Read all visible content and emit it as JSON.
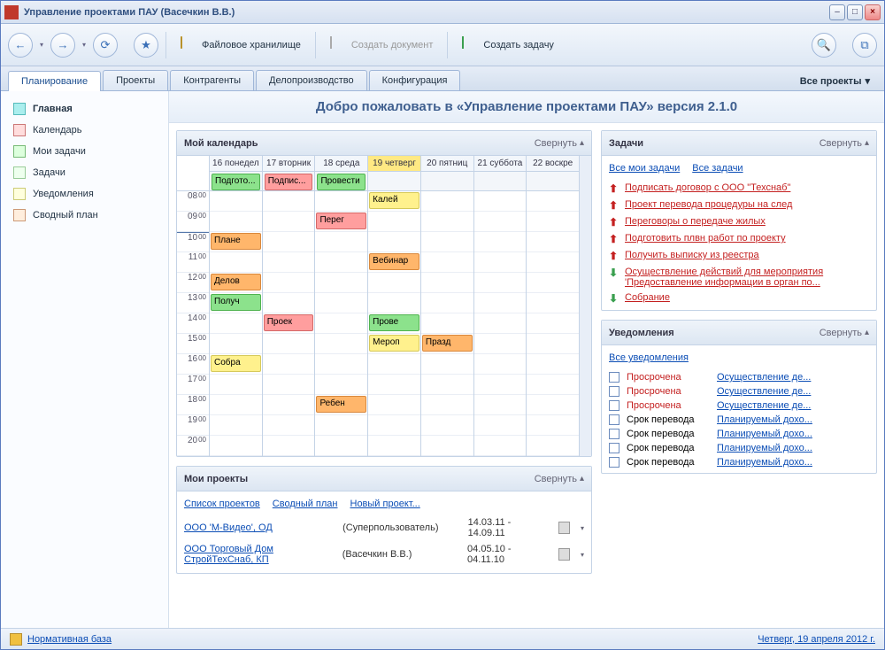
{
  "window": {
    "title": "Управление проектами ПАУ (Васечкин В.В.)"
  },
  "toolbar": {
    "file_storage": "Файловое хранилище",
    "create_doc": "Создать документ",
    "create_task": "Создать задачу"
  },
  "tabs": {
    "items": [
      "Планирование",
      "Проекты",
      "Контрагенты",
      "Делопроизводство",
      "Конфигурация"
    ],
    "projects": "Все проекты"
  },
  "sidebar": {
    "items": [
      {
        "label": "Главная"
      },
      {
        "label": "Календарь"
      },
      {
        "label": "Мои задачи"
      },
      {
        "label": "Задачи"
      },
      {
        "label": "Уведомления"
      },
      {
        "label": "Сводный план"
      }
    ]
  },
  "welcome": "Добро пожаловать в «Управление проектами ПАУ» версия 2.1.0",
  "calendar": {
    "title": "Мой календарь",
    "collapse": "Свернуть",
    "days": [
      "16 понедел",
      "17 вторник",
      "18 среда",
      "19 четверг",
      "20 пятниц",
      "21 суббота",
      "22 воскре"
    ],
    "today_index": 3,
    "times": [
      "08",
      "09",
      "10",
      "11",
      "12",
      "13",
      "14",
      "15",
      "16",
      "17",
      "18",
      "19",
      "20"
    ],
    "allday": {
      "0": "Подгото...",
      "1": "Подпис...",
      "2": "Провести"
    },
    "events": [
      {
        "day": 0,
        "slot": 2,
        "label": "Плане",
        "color": "orange"
      },
      {
        "day": 0,
        "slot": 4,
        "label": "Делов",
        "color": "orange"
      },
      {
        "day": 0,
        "slot": 5,
        "label": "Получ",
        "color": "green"
      },
      {
        "day": 0,
        "slot": 8,
        "label": "Собра",
        "color": "yellow"
      },
      {
        "day": 1,
        "slot": 6,
        "label": "Проек",
        "color": "pink"
      },
      {
        "day": 2,
        "slot": 1,
        "label": "Перег",
        "color": "pink"
      },
      {
        "day": 2,
        "slot": 10,
        "label": "Ребен",
        "color": "orange"
      },
      {
        "day": 3,
        "slot": 0,
        "label": "Калей",
        "color": "yellow"
      },
      {
        "day": 3,
        "slot": 3,
        "label": "Вебинар",
        "color": "orange"
      },
      {
        "day": 3,
        "slot": 6,
        "label": "Прове",
        "color": "green"
      },
      {
        "day": 3,
        "slot": 7,
        "label": "Мероп",
        "color": "yellow"
      },
      {
        "day": 4,
        "slot": 7,
        "label": "Празд",
        "color": "orange"
      }
    ]
  },
  "my_projects": {
    "title": "Мои проекты",
    "collapse": "Свернуть",
    "links": [
      "Список проектов",
      "Сводный план",
      "Новый проект..."
    ],
    "rows": [
      {
        "name": "ООО 'М-Видео', ОД",
        "user": "(Суперпользователь)",
        "dates": "14.03.11 - 14.09.11"
      },
      {
        "name": "ООО Торговый Дом СтройТехСнаб, КП",
        "user": "(Васечкин В.В.)",
        "dates": "04.05.10 - 04.11.10"
      }
    ]
  },
  "tasks": {
    "title": "Задачи",
    "collapse": "Свернуть",
    "links": [
      "Все мои задачи",
      "Все задачи"
    ],
    "items": [
      {
        "dir": "up",
        "label": "Подписать договор с ООО \"Техснаб\""
      },
      {
        "dir": "up",
        "label": "Проект перевода процедуры на след"
      },
      {
        "dir": "up",
        "label": "Переговоры о передаче жилых"
      },
      {
        "dir": "up",
        "label": "Подготовить плвн работ по проекту"
      },
      {
        "dir": "up",
        "label": "Получить выписку из реестра"
      },
      {
        "dir": "down",
        "label": "Осуществление действий для мероприятия 'Предоставление информации в орган по..."
      },
      {
        "dir": "down",
        "label": "Собрание"
      }
    ]
  },
  "notifications": {
    "title": "Уведомления",
    "collapse": "Свернуть",
    "link": "Все уведомления",
    "items": [
      {
        "status": "Просрочена",
        "red": true,
        "desc": "Осуществление де..."
      },
      {
        "status": "Просрочена",
        "red": true,
        "desc": "Осуществление де..."
      },
      {
        "status": "Просрочена",
        "red": true,
        "desc": "Осуществление де..."
      },
      {
        "status": "Срок перевода",
        "red": false,
        "desc": "Планируемый дохо..."
      },
      {
        "status": "Срок перевода",
        "red": false,
        "desc": "Планируемый дохо..."
      },
      {
        "status": "Срок перевода",
        "red": false,
        "desc": "Планируемый дохо..."
      },
      {
        "status": "Срок перевода",
        "red": false,
        "desc": "Планируемый дохо..."
      }
    ]
  },
  "footer": {
    "norm": "Нормативная база",
    "date": "Четверг, 19 апреля 2012 г."
  }
}
